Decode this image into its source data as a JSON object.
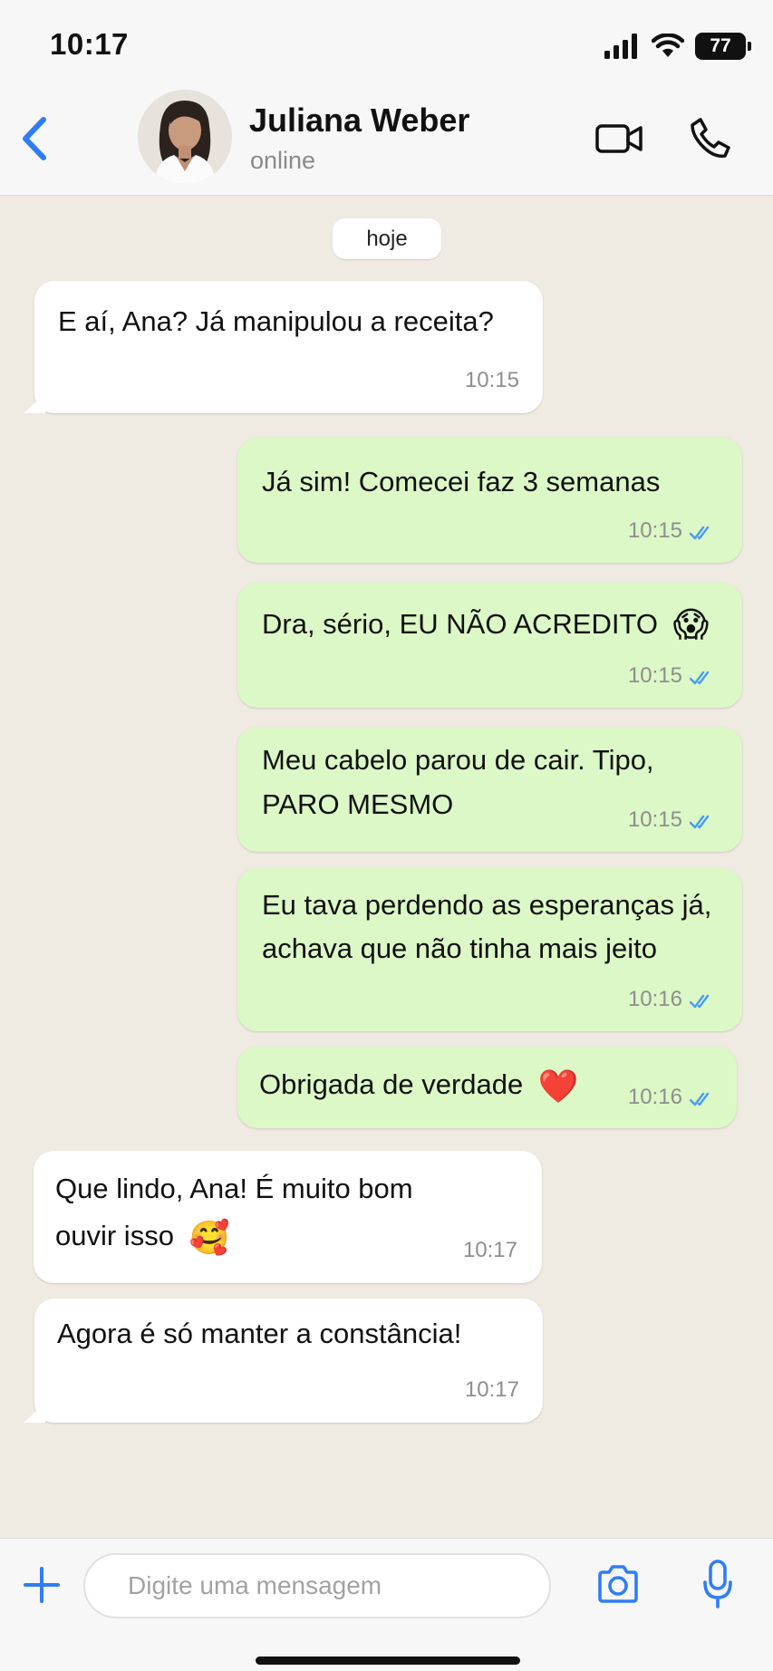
{
  "status_bar": {
    "time": "10:17",
    "battery": "77",
    "signal_icon": "cellular-signal-icon",
    "wifi_icon": "wifi-icon"
  },
  "header": {
    "contact_name": "Juliana Weber",
    "contact_status": "online",
    "back_icon": "chevron-left-icon",
    "video_icon": "video-camera-icon",
    "call_icon": "phone-icon"
  },
  "chat": {
    "date_label": "hoje",
    "messages": [
      {
        "direction": "in",
        "text": "E aí, Ana? Já manipulou a receita?",
        "time": "10:15"
      },
      {
        "direction": "out",
        "text": "Já sim! Comecei faz 3 semanas",
        "time": "10:15",
        "read": true
      },
      {
        "direction": "out",
        "text": "Dra, sério, EU NÃO ACREDITO",
        "emoji": "😱",
        "time": "10:15",
        "read": true
      },
      {
        "direction": "out",
        "lines": [
          "Meu cabelo parou de cair. Tipo,",
          "PARO MESMO"
        ],
        "time": "10:15",
        "read": true
      },
      {
        "direction": "out",
        "lines": [
          "Eu tava perdendo as esperanças já,",
          "achava que não tinha mais jeito"
        ],
        "time": "10:16",
        "read": true
      },
      {
        "direction": "out",
        "text": "Obrigada de verdade",
        "emoji": "❤️",
        "time": "10:16",
        "read": true
      },
      {
        "direction": "in",
        "lines": [
          "Que lindo, Ana! É muito bom",
          "ouvir isso"
        ],
        "emoji": "🥰",
        "time": "10:17"
      },
      {
        "direction": "in",
        "text": "Agora é só manter a constância!",
        "time": "10:17"
      }
    ]
  },
  "composer": {
    "placeholder": "Digite uma mensagem",
    "plus_icon": "plus-icon",
    "camera_icon": "camera-icon",
    "mic_icon": "microphone-icon"
  },
  "colors": {
    "accent": "#2f7df6",
    "chat_background": "#efeae2",
    "outgoing_bubble": "#dcf8c6",
    "incoming_bubble": "#ffffff",
    "read_ticks": "#4a9cf5"
  }
}
